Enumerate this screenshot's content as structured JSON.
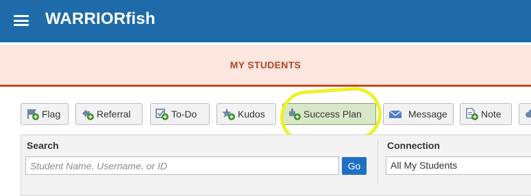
{
  "app": {
    "title": "WARRIORfish"
  },
  "banner": {
    "title": "MY STUDENTS"
  },
  "toolbar": {
    "buttons": [
      {
        "label": "Flag",
        "icon": "flag-add-icon"
      },
      {
        "label": "Referral",
        "icon": "referral-add-icon"
      },
      {
        "label": "To-Do",
        "icon": "todo-add-icon"
      },
      {
        "label": "Kudos",
        "icon": "kudos-add-icon"
      },
      {
        "label": "Success Plan",
        "icon": "success-plan-add-icon"
      },
      {
        "label": "Message",
        "icon": "envelope-icon"
      },
      {
        "label": "Note",
        "icon": "note-add-icon"
      }
    ]
  },
  "search": {
    "label": "Search",
    "placeholder": "Student Name, Username, or ID",
    "go_label": "Go"
  },
  "connection": {
    "label": "Connection",
    "selected": "All My Students"
  },
  "colors": {
    "header_bg": "#1f6aa8",
    "banner_bg": "#fbe6e0",
    "banner_text": "#b2451c",
    "accent_green": "#4c9a2a",
    "highlight": "#ecf22a",
    "go_button": "#1f6fc5"
  }
}
